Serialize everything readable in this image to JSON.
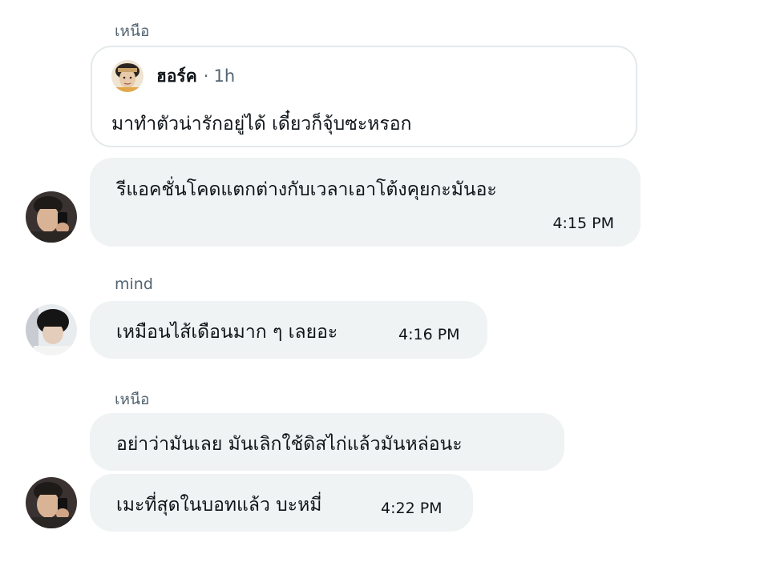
{
  "group1": {
    "sender": "เหนือ",
    "quote": {
      "name": "ฮอร์ค",
      "separator": "·",
      "time": "1h",
      "text": "มาทำตัวน่ารักอยู่ได้ เดี๋ยวก็จุ้บซะหรอก"
    },
    "message": {
      "text": "รีแอคชั่นโคดแตกต่างกับเวลาเอาโต้งคุยกะมันอะ",
      "time": "4:15 PM"
    }
  },
  "group2": {
    "sender": "mind",
    "message": {
      "text": "เหมือนไส้เดือนมาก ๆ เลยอะ",
      "time": "4:16 PM"
    }
  },
  "group3": {
    "sender": "เหนือ",
    "message1": {
      "text": "อย่าว่ามันเลย มันเลิกใช้ดิสไก่แล้วมันหล่อนะ"
    },
    "message2": {
      "text": "เมะที่สุดในบอทแล้ว บะหมี่",
      "time": "4:22 PM"
    }
  },
  "colors": {
    "bubble": "#eff3f4",
    "secondary_text": "#536471",
    "primary_text": "#0f1419",
    "quote_border": "#e4e9ec"
  }
}
